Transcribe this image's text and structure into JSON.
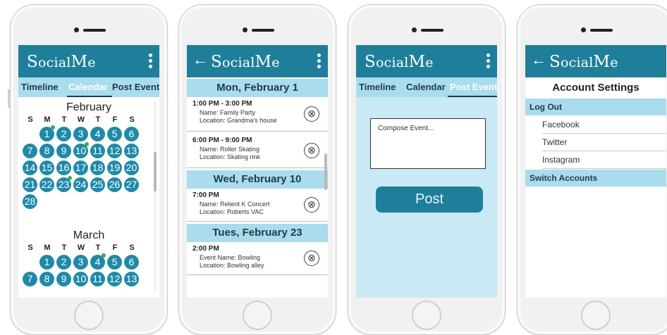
{
  "brand": {
    "cap1": "S",
    "rest1": "ocial",
    "cap2": "M",
    "rest2": "e"
  },
  "colors": {
    "primary": "#1f7f9a",
    "tab_bar": "#a9dcec",
    "day_circle": "#1f8aa8",
    "event_dot": "#36b04a",
    "compose_bg": "#c9e9f4"
  },
  "screens": {
    "calendar": {
      "tabs": [
        "Timeline",
        "Calendar",
        "Post Event"
      ],
      "active_tab": "Calendar",
      "weekdays": [
        "S",
        "M",
        "T",
        "W",
        "T",
        "F",
        "S"
      ],
      "months": [
        {
          "name": "February",
          "start_weekday": 1,
          "days": 28,
          "marked_days": [
            1,
            10,
            23
          ]
        },
        {
          "name": "March",
          "start_weekday": 1,
          "days_visible": 13,
          "marked_days": [
            4
          ]
        }
      ]
    },
    "events": {
      "groups": [
        {
          "date": "Mon, February 1",
          "events": [
            {
              "time": "1:00 PM - 3:00 PM",
              "lines": [
                "Name: Family Party",
                "Location: Grandma's house"
              ]
            },
            {
              "time": "6:00 PM - 9:00 PM",
              "lines": [
                "Name: Roller Skating",
                "Location: Skating rink"
              ]
            }
          ]
        },
        {
          "date": "Wed, February 10",
          "events": [
            {
              "time": "7:00 PM",
              "lines": [
                "Name: Relient K Concert",
                "Location: Roberts VAC"
              ]
            }
          ]
        },
        {
          "date": "Tues, February 23",
          "events": [
            {
              "time": "2:00 PM",
              "lines": [
                "Event Name: Bowling",
                "Location: Bowling alley"
              ]
            }
          ]
        }
      ],
      "delete_glyph": "⊗"
    },
    "post": {
      "tabs": [
        "Timeline",
        "Calendar",
        "Post Event"
      ],
      "active_tab": "Post Event",
      "compose_placeholder": "Compose Event...",
      "post_label": "Post"
    },
    "settings": {
      "title": "Account Settings",
      "logout_header": "Log Out",
      "accounts": [
        "Facebook",
        "Twitter",
        "Instagram"
      ],
      "switch_header": "Switch Accounts"
    }
  }
}
